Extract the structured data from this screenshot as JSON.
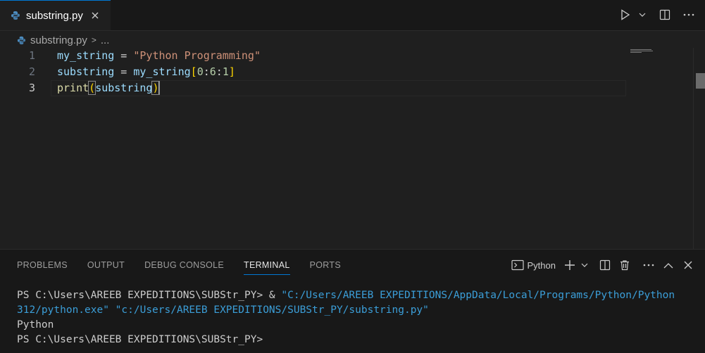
{
  "tab": {
    "filename": "substring.py"
  },
  "breadcrumb": {
    "file": "substring.py",
    "separator": ">",
    "more": "..."
  },
  "editor": {
    "lines": [
      {
        "number": "1",
        "var": "my_string",
        "eq": " = ",
        "str": "\"Python Programming\""
      },
      {
        "number": "2",
        "var": "substring",
        "eq": " = ",
        "var2": "my_string",
        "open": "[",
        "n0": "0",
        "c1": ":",
        "n6": "6",
        "c2": ":",
        "n1": "1",
        "close": "]"
      },
      {
        "number": "3",
        "fn": "print",
        "open": "(",
        "arg": "substring",
        "close": ")"
      }
    ]
  },
  "panel": {
    "tabs": [
      "PROBLEMS",
      "OUTPUT",
      "DEBUG CONSOLE",
      "TERMINAL",
      "PORTS"
    ],
    "active_tab": "TERMINAL",
    "terminal_profile": "Python",
    "terminal": {
      "line1_prompt": "PS C:\\Users\\AREEB EXPEDITIONS\\SUBStr_PY> ",
      "line1_amp": "& ",
      "line1_str": "\"C:/Users/AREEB EXPEDITIONS/AppData/Local/Programs/Python/Python312/python.exe\" \"c:/Users/AREEB EXPEDITIONS/SUBStr_PY/substring.py\"",
      "output": "Python",
      "line3_prompt": "PS C:\\Users\\AREEB EXPEDITIONS\\SUBStr_PY>"
    }
  },
  "colors": {
    "accent": "#0078d4",
    "string": "#ce9178",
    "variable": "#9cdcfe",
    "function": "#dcdcaa",
    "number": "#b5cea8"
  }
}
